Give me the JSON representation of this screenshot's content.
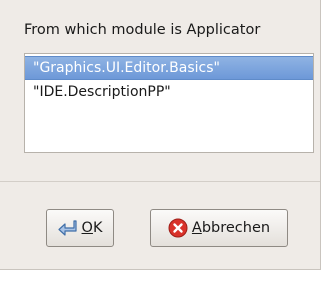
{
  "dialog": {
    "prompt": "From which module is Applicator",
    "list": {
      "items": [
        "\"Graphics.UI.Editor.Basics\"",
        "\"IDE.DescriptionPP\""
      ],
      "selected_index": 0
    },
    "buttons": {
      "ok": {
        "mnemonic": "O",
        "rest": "K",
        "icon": "enter-arrow-icon"
      },
      "cancel": {
        "mnemonic": "A",
        "rest": "bbrechen",
        "icon": "red-x-cancel-icon"
      }
    }
  },
  "colors": {
    "dialog_bg": "#efebe7",
    "selection": "#6d98d8",
    "cancel_icon": "#d9322a"
  }
}
